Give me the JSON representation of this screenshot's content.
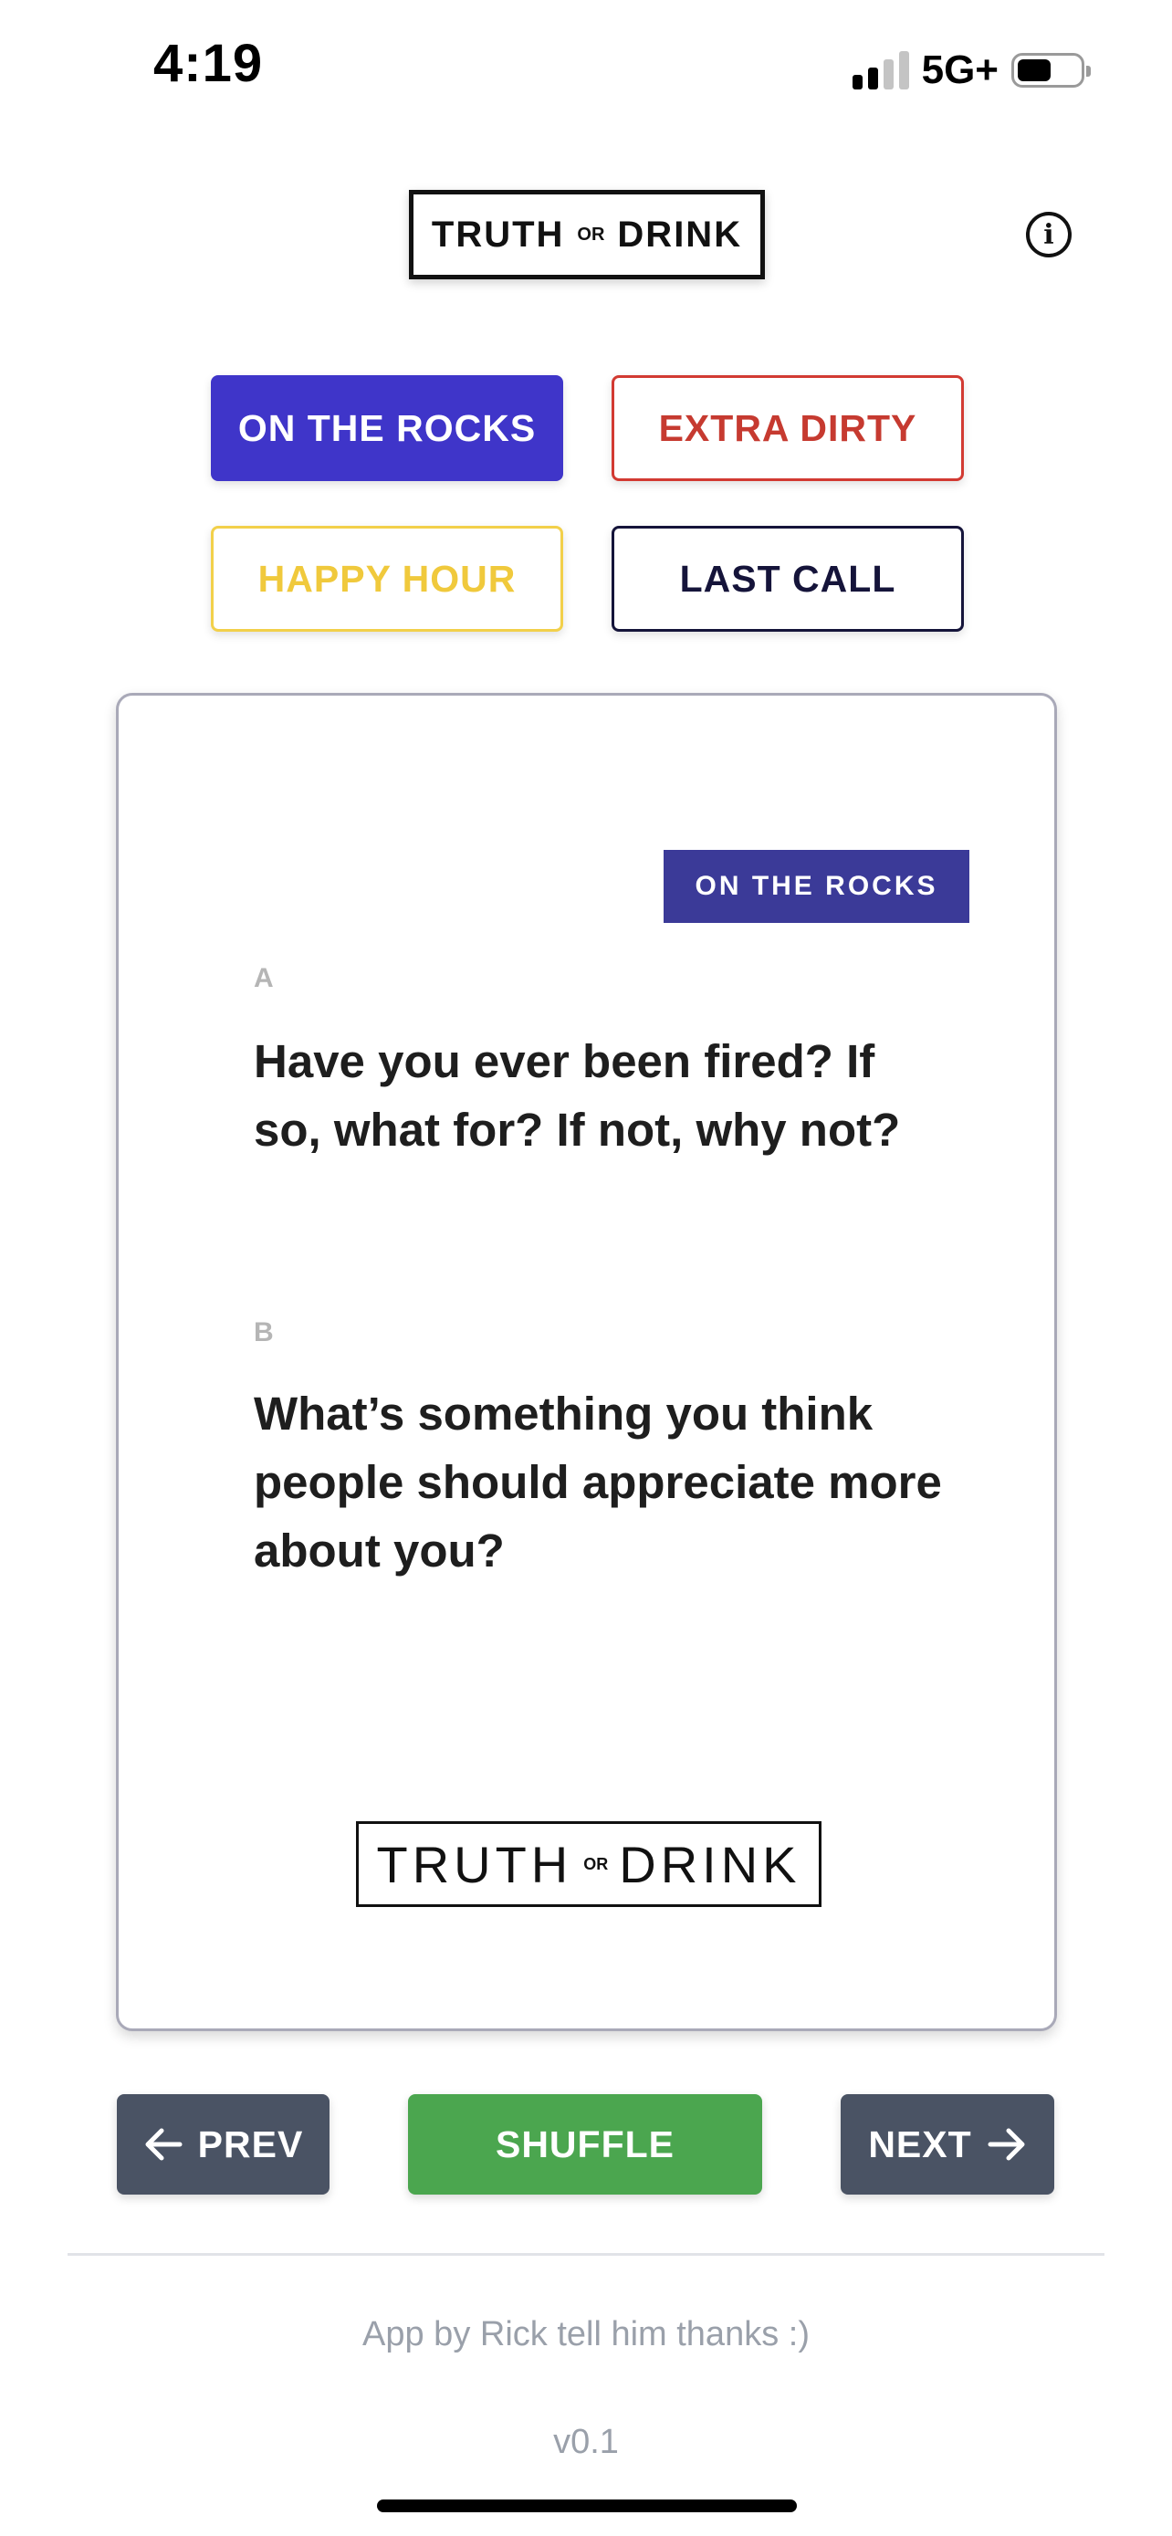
{
  "status_bar": {
    "time": "4:19",
    "network": "5G+",
    "signal_bars": 2,
    "battery_level": 0.6
  },
  "header": {
    "logo": {
      "word1": "TRUTH",
      "or": "OR",
      "word2": "DRINK"
    },
    "info_icon": "info-circle-icon"
  },
  "categories": [
    {
      "label": "ON THE ROCKS",
      "color": "#3f35c9",
      "selected": true
    },
    {
      "label": "EXTRA DIRTY",
      "color": "#c63a30",
      "selected": false
    },
    {
      "label": "HAPPY HOUR",
      "color": "#f0c93c",
      "selected": false
    },
    {
      "label": "LAST CALL",
      "color": "#15143a",
      "selected": false
    }
  ],
  "card": {
    "badge": "ON THE ROCKS",
    "badge_color": "#3b3a98",
    "question_a": {
      "letter": "A",
      "text": "Have you ever been fired? If so, what for? If not, why not?"
    },
    "question_b": {
      "letter": "B",
      "text": "What’s something you think people should appreciate more about you?"
    },
    "logo": {
      "word1": "TRUTH",
      "or": "OR",
      "word2": "DRINK"
    }
  },
  "nav": {
    "prev_label": "PREV",
    "shuffle_label": "SHUFFLE",
    "next_label": "NEXT",
    "prev_icon": "arrow-left-icon",
    "next_icon": "arrow-right-icon",
    "nav_color": "#4a5364",
    "shuffle_color": "#4ba64f"
  },
  "footer": {
    "credit": "App by Rick tell him thanks :)",
    "version": "v0.1"
  }
}
